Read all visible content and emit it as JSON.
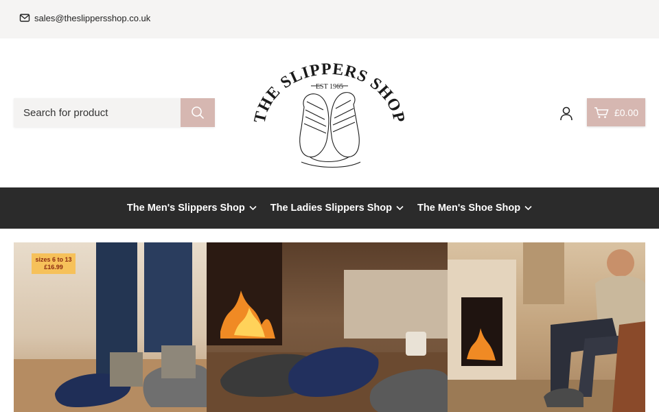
{
  "topbar": {
    "email": "sales@theslippersshop.co.uk",
    "icon": "mail-icon"
  },
  "search": {
    "placeholder": "Search for product",
    "button_icon": "search-icon"
  },
  "logo": {
    "brand_text": "THE SLIPPERS SHOP",
    "est_text": "EST 1965"
  },
  "account": {
    "icon": "user-icon"
  },
  "cart": {
    "total": "£0.00",
    "icon": "cart-icon"
  },
  "nav": {
    "items": [
      {
        "label": "The Men's Slippers Shop"
      },
      {
        "label": "The Ladies Slippers Shop"
      },
      {
        "label": "The Men's Shoe Shop"
      }
    ]
  },
  "banner": {
    "badge_line1": "sizes 6 to 13",
    "badge_line2": "£16.99"
  },
  "colors": {
    "accent": "#d6b7b1",
    "nav_bg": "#2b2b2b",
    "topbar_bg": "#f5f4f3"
  }
}
